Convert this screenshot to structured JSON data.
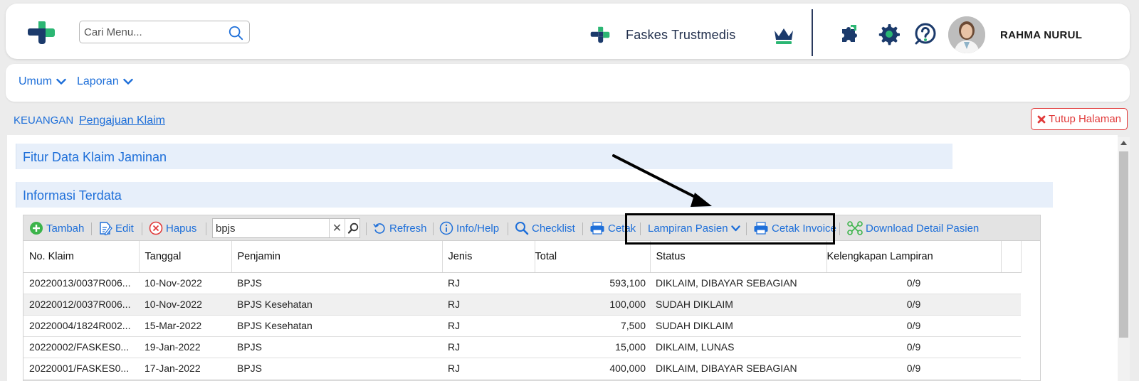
{
  "header": {
    "search_placeholder": "Cari Menu...",
    "org_name": "Faskes Trustmedis",
    "user_name": "RAHMA NURUL"
  },
  "menu": {
    "items": [
      {
        "label": "Umum"
      },
      {
        "label": "Laporan"
      }
    ]
  },
  "breadcrumb": {
    "root": "KEUANGAN",
    "current": "Pengajuan Klaim"
  },
  "close_button": "Tutup Halaman",
  "sections": {
    "feature_title": "Fitur Data Klaim Jaminan",
    "info_title": "Informasi Terdata"
  },
  "toolbar": {
    "tambah": "Tambah",
    "edit": "Edit",
    "hapus": "Hapus",
    "search_value": "bpjs",
    "clear_symbol": "✕",
    "refresh": "Refresh",
    "info_help": "Info/Help",
    "checklist": "Checklist",
    "cetak": "Cetak",
    "lampiran_pasien": "Lampiran Pasien",
    "cetak_invoice": "Cetak Invoice",
    "download_detail": "Download Detail Pasien"
  },
  "table": {
    "columns": [
      "No. Klaim",
      "Tanggal",
      "Penjamin",
      "Jenis",
      "Total",
      "Status",
      "Kelengkapan Lampiran"
    ],
    "rows": [
      {
        "no_klaim": "20220013/0037R006...",
        "tanggal": "10-Nov-2022",
        "penjamin": "BPJS",
        "jenis": "RJ",
        "total": "593,100",
        "status": "DIKLAIM, DIBAYAR SEBAGIAN",
        "lampiran": "0/9"
      },
      {
        "no_klaim": "20220012/0037R006...",
        "tanggal": "10-Nov-2022",
        "penjamin": "BPJS Kesehatan",
        "jenis": "RJ",
        "total": "100,000",
        "status": "SUDAH DIKLAIM",
        "lampiran": "0/9"
      },
      {
        "no_klaim": "20220004/1824R002...",
        "tanggal": "15-Mar-2022",
        "penjamin": "BPJS Kesehatan",
        "jenis": "RJ",
        "total": "7,500",
        "status": "SUDAH DIKLAIM",
        "lampiran": "0/9"
      },
      {
        "no_klaim": "20220002/FASKES0...",
        "tanggal": "19-Jan-2022",
        "penjamin": "BPJS",
        "jenis": "RJ",
        "total": "15,000",
        "status": "DIKLAIM, LUNAS",
        "lampiran": "0/9"
      },
      {
        "no_klaim": "20220001/FASKES0...",
        "tanggal": "17-Jan-2022",
        "penjamin": "BPJS",
        "jenis": "RJ",
        "total": "400,000",
        "status": "DIKLAIM, DIBAYAR SEBAGIAN",
        "lampiran": "0/9"
      }
    ]
  },
  "colors": {
    "brand_blue": "#1e6fd9",
    "brand_navy": "#1b3a6b",
    "brand_green": "#2bb673",
    "danger_red": "#e13a3a"
  }
}
